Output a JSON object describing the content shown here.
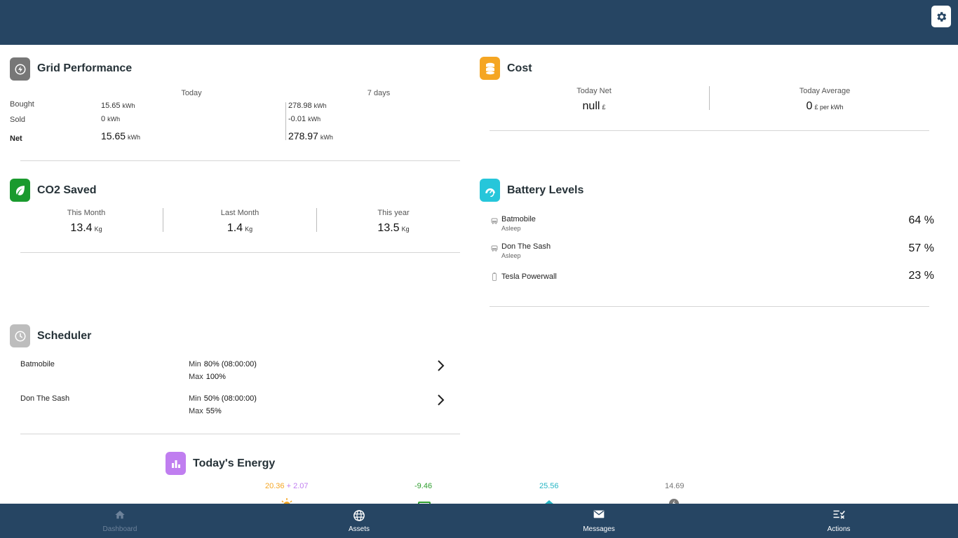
{
  "grid": {
    "title": "Grid Performance",
    "col_today": "Today",
    "col_7days": "7 days",
    "rows": [
      {
        "label": "Bought",
        "today": "15.65",
        "today_unit": "kWh",
        "week": "278.98",
        "week_unit": "kWh"
      },
      {
        "label": "Sold",
        "today": "0",
        "today_unit": "kWh",
        "week": "-0.01",
        "week_unit": "kWh"
      },
      {
        "label": "Net",
        "today": "15.65",
        "today_unit": "kWh",
        "week": "278.97",
        "week_unit": "kWh"
      }
    ]
  },
  "cost": {
    "title": "Cost",
    "today_net_label": "Today Net",
    "today_net_value": "null",
    "today_net_unit": "£",
    "today_avg_label": "Today Average",
    "today_avg_value": "0",
    "today_avg_unit": "£ per kWh"
  },
  "co2": {
    "title": "CO2 Saved",
    "items": [
      {
        "label": "This Month",
        "value": "13.4",
        "unit": "Kg"
      },
      {
        "label": "Last Month",
        "value": "1.4",
        "unit": "Kg"
      },
      {
        "label": "This year",
        "value": "13.5",
        "unit": "Kg"
      }
    ]
  },
  "battery": {
    "title": "Battery Levels",
    "items": [
      {
        "name": "Batmobile",
        "status": "Asleep",
        "percent": "64 %"
      },
      {
        "name": "Don The Sash",
        "status": "Asleep",
        "percent": "57 %"
      },
      {
        "name": "Tesla Powerwall",
        "status": "",
        "percent": "23 %"
      }
    ]
  },
  "scheduler": {
    "title": "Scheduler",
    "min_label": "Min",
    "max_label": "Max",
    "items": [
      {
        "name": "Batmobile",
        "min": "80% (08:00:00)",
        "max": "100%"
      },
      {
        "name": "Don The Sash",
        "min": "50% (08:00:00)",
        "max": "55%"
      }
    ]
  },
  "energy": {
    "title": "Today's Energy",
    "solar": "20.36",
    "plus": "+",
    "solar_extra": "2.07",
    "grid": "-9.46",
    "home": "25.56",
    "other": "14.69",
    "colors": {
      "solar": "#f5a623",
      "extra": "#c07ef0",
      "grid": "#2e9e2e",
      "home": "#26b5c4",
      "other": "#777777"
    }
  },
  "nav": {
    "items": [
      {
        "label": "Dashboard",
        "icon": "home-icon"
      },
      {
        "label": "Assets",
        "icon": "globe-icon"
      },
      {
        "label": "Messages",
        "icon": "mail-icon"
      },
      {
        "label": "Actions",
        "icon": "actions-icon"
      }
    ]
  },
  "colors": {
    "header": "#264563",
    "grid_icon": "#777777",
    "cost_icon": "#f5a623",
    "co2_icon": "#1a9a2e",
    "battery_icon": "#26c6da",
    "scheduler_icon": "#bdbdbd",
    "energy_icon": "#c07ef0"
  }
}
